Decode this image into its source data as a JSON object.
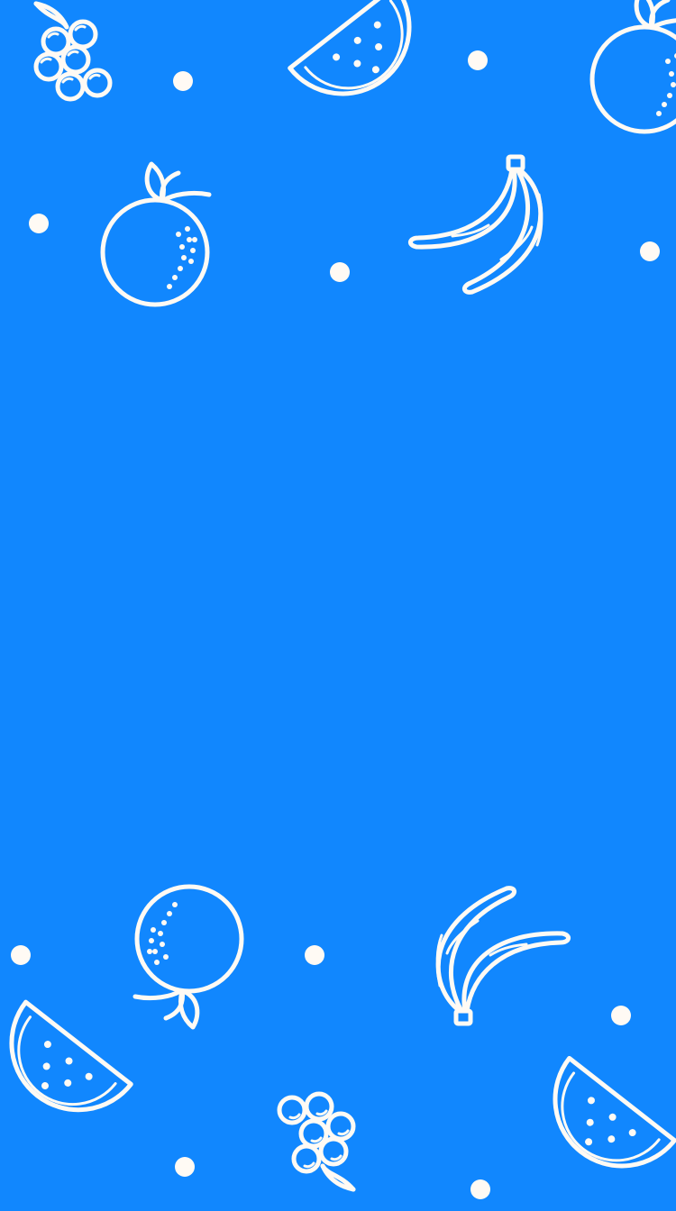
{
  "screen": {
    "name": "fruit-pattern-background",
    "background_color": "#1187FE",
    "line_color": "#FFFAF4"
  },
  "icons": [
    "grapes-icon",
    "watermelon-slice-icon",
    "orange-icon",
    "banana-icon",
    "dot"
  ]
}
